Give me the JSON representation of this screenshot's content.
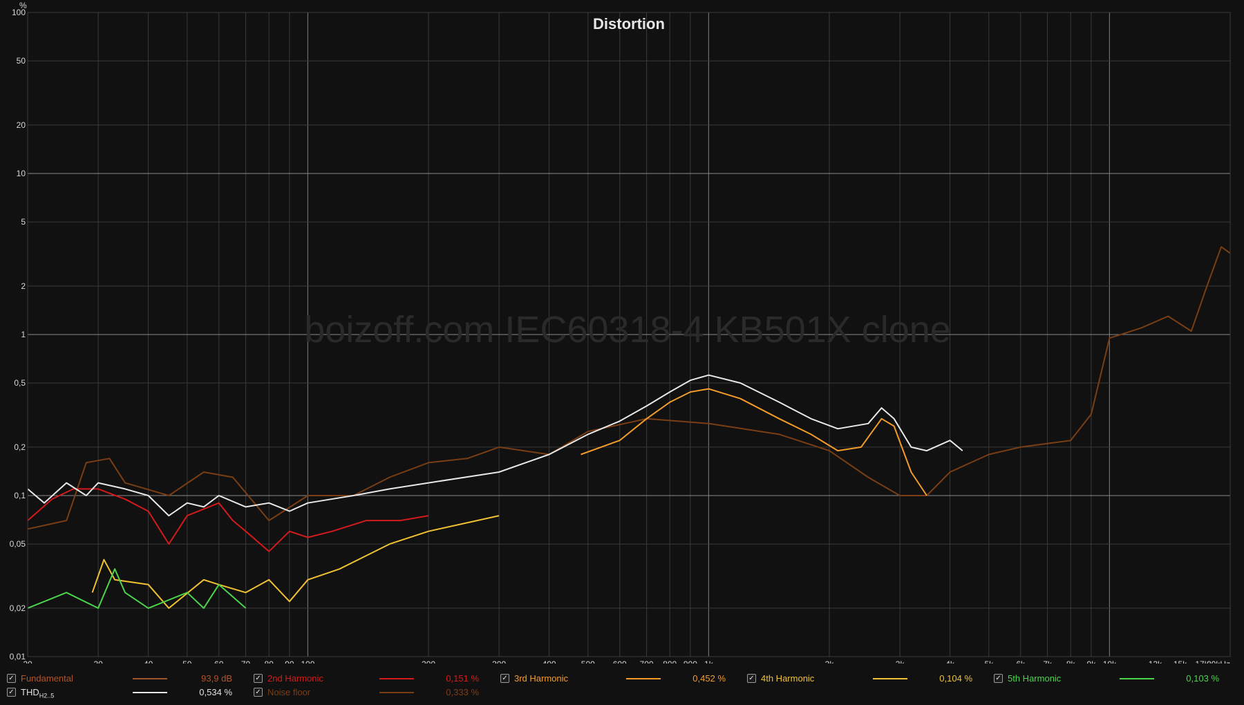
{
  "window": {
    "title": "Distortion",
    "watermark": "boizoff.com IEC60318-4 KB501X clone",
    "y_unit": "%",
    "x_unit_suffix": "kHz"
  },
  "chart_data": {
    "type": "line",
    "title": "Distortion",
    "xscale": "log",
    "yscale": "log",
    "xlim": [
      20,
      20000
    ],
    "ylim": [
      0.01,
      100
    ],
    "grid": true,
    "legend_placement": "bottom",
    "yticks": [
      {
        "v": 100,
        "label": "100"
      },
      {
        "v": 50,
        "label": "50"
      },
      {
        "v": 20,
        "label": "20"
      },
      {
        "v": 10,
        "label": "10"
      },
      {
        "v": 5,
        "label": "5"
      },
      {
        "v": 2,
        "label": "2"
      },
      {
        "v": 1,
        "label": "1"
      },
      {
        "v": 0.5,
        "label": "0,5"
      },
      {
        "v": 0.2,
        "label": "0,2"
      },
      {
        "v": 0.1,
        "label": "0,1"
      },
      {
        "v": 0.05,
        "label": "0,05"
      },
      {
        "v": 0.02,
        "label": "0,02"
      },
      {
        "v": 0.01,
        "label": "0,01"
      }
    ],
    "xticks": [
      {
        "v": 20,
        "label": "20"
      },
      {
        "v": 30,
        "label": "30"
      },
      {
        "v": 40,
        "label": "40"
      },
      {
        "v": 50,
        "label": "50"
      },
      {
        "v": 60,
        "label": "60"
      },
      {
        "v": 70,
        "label": "70"
      },
      {
        "v": 80,
        "label": "80"
      },
      {
        "v": 90,
        "label": "90"
      },
      {
        "v": 100,
        "label": "100"
      },
      {
        "v": 200,
        "label": "200"
      },
      {
        "v": 300,
        "label": "300"
      },
      {
        "v": 400,
        "label": "400"
      },
      {
        "v": 500,
        "label": "500"
      },
      {
        "v": 600,
        "label": "600"
      },
      {
        "v": 700,
        "label": "700"
      },
      {
        "v": 800,
        "label": "800"
      },
      {
        "v": 900,
        "label": "900"
      },
      {
        "v": 1000,
        "label": "1k"
      },
      {
        "v": 2000,
        "label": "2k"
      },
      {
        "v": 3000,
        "label": "3k"
      },
      {
        "v": 4000,
        "label": "4k"
      },
      {
        "v": 5000,
        "label": "5k"
      },
      {
        "v": 6000,
        "label": "6k"
      },
      {
        "v": 7000,
        "label": "7k"
      },
      {
        "v": 8000,
        "label": "8k"
      },
      {
        "v": 9000,
        "label": "9k"
      },
      {
        "v": 10000,
        "label": "10k"
      },
      {
        "v": 13000,
        "label": "13k"
      },
      {
        "v": 15000,
        "label": "15k"
      },
      {
        "v": 17000,
        "label": "17k"
      },
      {
        "v": 20000,
        "label": "20kHz"
      }
    ],
    "series": [
      {
        "key": "noise",
        "name": "Noise floor",
        "color": "#7a3e14",
        "points": [
          [
            20,
            0.062
          ],
          [
            25,
            0.07
          ],
          [
            28,
            0.16
          ],
          [
            32,
            0.17
          ],
          [
            35,
            0.12
          ],
          [
            45,
            0.1
          ],
          [
            55,
            0.14
          ],
          [
            65,
            0.13
          ],
          [
            80,
            0.07
          ],
          [
            100,
            0.1
          ],
          [
            130,
            0.1
          ],
          [
            160,
            0.13
          ],
          [
            200,
            0.16
          ],
          [
            250,
            0.17
          ],
          [
            300,
            0.2
          ],
          [
            400,
            0.18
          ],
          [
            500,
            0.25
          ],
          [
            700,
            0.3
          ],
          [
            1000,
            0.28
          ],
          [
            1500,
            0.24
          ],
          [
            2000,
            0.19
          ],
          [
            2500,
            0.13
          ],
          [
            3000,
            0.1
          ],
          [
            3500,
            0.1
          ],
          [
            4000,
            0.14
          ],
          [
            5000,
            0.18
          ],
          [
            6000,
            0.2
          ],
          [
            8000,
            0.22
          ],
          [
            9000,
            0.32
          ],
          [
            10000,
            0.95
          ],
          [
            12000,
            1.1
          ],
          [
            14000,
            1.3
          ],
          [
            16000,
            1.05
          ],
          [
            17500,
            2.0
          ],
          [
            19000,
            3.5
          ],
          [
            20000,
            3.2
          ]
        ]
      },
      {
        "key": "h2",
        "name": "2nd Harmonic",
        "color": "#d31b1b",
        "points": [
          [
            20,
            0.07
          ],
          [
            23,
            0.095
          ],
          [
            26,
            0.11
          ],
          [
            30,
            0.11
          ],
          [
            35,
            0.095
          ],
          [
            40,
            0.08
          ],
          [
            45,
            0.05
          ],
          [
            50,
            0.075
          ],
          [
            60,
            0.09
          ],
          [
            65,
            0.07
          ],
          [
            70,
            0.06
          ],
          [
            80,
            0.045
          ],
          [
            90,
            0.06
          ],
          [
            100,
            0.055
          ],
          [
            115,
            0.06
          ],
          [
            140,
            0.07
          ],
          [
            170,
            0.07
          ],
          [
            200,
            0.075
          ]
        ]
      },
      {
        "key": "h3",
        "name": "3rd Harmonic",
        "color": "#f39c2a",
        "points": [
          [
            480,
            0.18
          ],
          [
            600,
            0.22
          ],
          [
            700,
            0.3
          ],
          [
            800,
            0.38
          ],
          [
            900,
            0.44
          ],
          [
            1000,
            0.46
          ],
          [
            1200,
            0.4
          ],
          [
            1500,
            0.3
          ],
          [
            1800,
            0.24
          ],
          [
            2100,
            0.19
          ],
          [
            2400,
            0.2
          ],
          [
            2700,
            0.3
          ],
          [
            2900,
            0.27
          ],
          [
            3200,
            0.14
          ],
          [
            3500,
            0.1
          ]
        ]
      },
      {
        "key": "h4",
        "name": "4th Harmonic",
        "color": "#f1c232",
        "points": [
          [
            29,
            0.025
          ],
          [
            31,
            0.04
          ],
          [
            33,
            0.03
          ],
          [
            40,
            0.028
          ],
          [
            45,
            0.02
          ],
          [
            55,
            0.03
          ],
          [
            60,
            0.028
          ],
          [
            70,
            0.025
          ],
          [
            80,
            0.03
          ],
          [
            90,
            0.022
          ],
          [
            100,
            0.03
          ],
          [
            120,
            0.035
          ],
          [
            160,
            0.05
          ],
          [
            200,
            0.06
          ],
          [
            300,
            0.075
          ]
        ]
      },
      {
        "key": "h5",
        "name": "5th Harmonic",
        "color": "#4cd44c",
        "points": [
          [
            20,
            0.02
          ],
          [
            25,
            0.025
          ],
          [
            30,
            0.02
          ],
          [
            33,
            0.035
          ],
          [
            35,
            0.025
          ],
          [
            40,
            0.02
          ],
          [
            50,
            0.025
          ],
          [
            55,
            0.02
          ],
          [
            60,
            0.028
          ],
          [
            70,
            0.02
          ]
        ]
      },
      {
        "key": "thd",
        "name": "THD",
        "color": "#e8e8e8",
        "points": [
          [
            20,
            0.11
          ],
          [
            22,
            0.09
          ],
          [
            25,
            0.12
          ],
          [
            28,
            0.1
          ],
          [
            30,
            0.12
          ],
          [
            35,
            0.11
          ],
          [
            40,
            0.1
          ],
          [
            45,
            0.075
          ],
          [
            50,
            0.09
          ],
          [
            55,
            0.085
          ],
          [
            60,
            0.1
          ],
          [
            70,
            0.085
          ],
          [
            80,
            0.09
          ],
          [
            90,
            0.08
          ],
          [
            100,
            0.09
          ],
          [
            130,
            0.1
          ],
          [
            160,
            0.11
          ],
          [
            200,
            0.12
          ],
          [
            300,
            0.14
          ],
          [
            400,
            0.18
          ],
          [
            500,
            0.24
          ],
          [
            600,
            0.29
          ],
          [
            700,
            0.36
          ],
          [
            800,
            0.44
          ],
          [
            900,
            0.52
          ],
          [
            1000,
            0.56
          ],
          [
            1200,
            0.5
          ],
          [
            1500,
            0.38
          ],
          [
            1800,
            0.3
          ],
          [
            2100,
            0.26
          ],
          [
            2500,
            0.28
          ],
          [
            2700,
            0.35
          ],
          [
            2900,
            0.3
          ],
          [
            3200,
            0.2
          ],
          [
            3500,
            0.19
          ],
          [
            4000,
            0.22
          ],
          [
            4300,
            0.19
          ]
        ]
      }
    ]
  },
  "legend": {
    "items": [
      {
        "key": "fundamental",
        "label": "Fundamental",
        "sub": "",
        "value": "93,9 dB",
        "color": "#a0522d",
        "label_color": "#b5542a",
        "value_color": "#b5542a",
        "checked": true
      },
      {
        "key": "h2",
        "label": "2nd Harmonic",
        "sub": "",
        "value": "0,151 %",
        "color": "#d31b1b",
        "label_color": "#d31b1b",
        "value_color": "#d31b1b",
        "checked": true
      },
      {
        "key": "h3",
        "label": "3rd Harmonic",
        "sub": "",
        "value": "0,452 %",
        "color": "#f39c2a",
        "label_color": "#f39c2a",
        "value_color": "#f39c2a",
        "checked": true
      },
      {
        "key": "h4",
        "label": "4th Harmonic",
        "sub": "",
        "value": "0,104 %",
        "color": "#f1c232",
        "label_color": "#f1c232",
        "value_color": "#f1c232",
        "checked": true
      },
      {
        "key": "h5",
        "label": "5th Harmonic",
        "sub": "",
        "value": "0,103 %",
        "color": "#4cd44c",
        "label_color": "#4cd44c",
        "value_color": "#4cd44c",
        "checked": true
      },
      {
        "key": "thd",
        "label": "THD",
        "sub": "H2..5",
        "value": "0,534 %",
        "color": "#e8e8e8",
        "label_color": "#e0e0e0",
        "value_color": "#e0e0e0",
        "checked": true
      },
      {
        "key": "noise",
        "label": "Noise floor",
        "sub": "",
        "value": "0,333 %",
        "color": "#7a3e14",
        "label_color": "#7a3e14",
        "value_color": "#7a3e14",
        "checked": true
      }
    ]
  }
}
